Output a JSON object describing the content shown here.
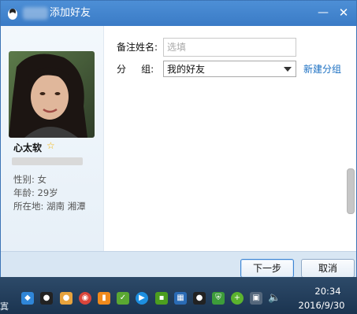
{
  "window": {
    "title": "添加好友",
    "minimize_glyph": "—",
    "close_glyph": "✕",
    "icon": "qq-penguin-icon"
  },
  "profile": {
    "nickname": "心太软",
    "star_glyph": "☆",
    "gender_label": "性别: 女",
    "age_label": "年龄: 29岁",
    "location_label": "所在地: 湖南  湘潭"
  },
  "form": {
    "remark_label": "备注姓名:",
    "remark_placeholder": "选填",
    "remark_value": "",
    "group_label": "分     组:",
    "group_selected": "我的好友",
    "new_group_link": "新建分组"
  },
  "buttons": {
    "next": "下一步",
    "cancel": "取消"
  },
  "taskbar": {
    "left_edge_text": "寘",
    "clock_time": "20:34",
    "clock_date": "2016/9/30"
  },
  "colors": {
    "titlebar": "#3a7bc6",
    "link": "#1a6fc2",
    "button_bar": "#d8e6f3",
    "taskbar": "#1b3450"
  }
}
